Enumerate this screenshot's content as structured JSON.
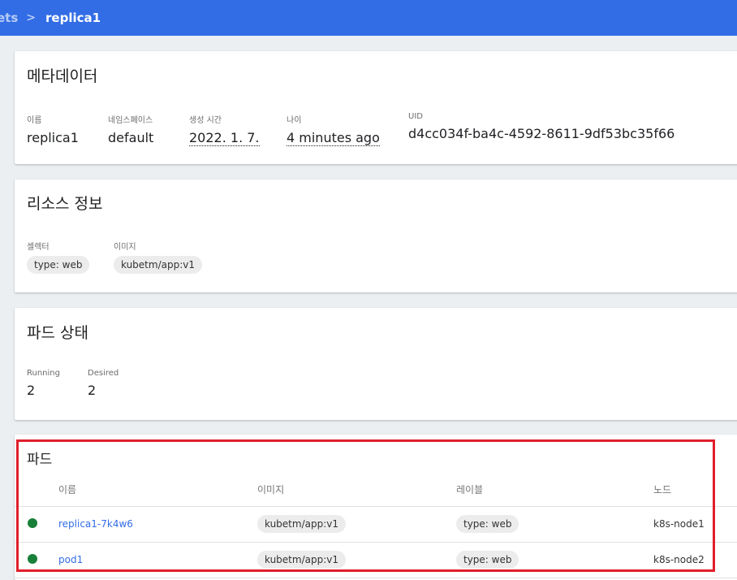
{
  "breadcrumb": {
    "previous": "ets",
    "separator": ">",
    "current": "replica1"
  },
  "metadata_card": {
    "title": "메타데이터",
    "fields": [
      {
        "label": "이름",
        "value": "replica1"
      },
      {
        "label": "네임스페이스",
        "value": "default"
      },
      {
        "label": "생성 시간",
        "value": "2022. 1. 7."
      },
      {
        "label": "나이",
        "value": "4 minutes ago"
      },
      {
        "label": "UID",
        "value": "d4cc034f-ba4c-4592-8611-9df53bc35f66"
      }
    ]
  },
  "resource_card": {
    "title": "리소스 정보",
    "selector_label": "셀렉터",
    "selector_chip": "type: web",
    "image_label": "이미지",
    "image_chip": "kubetm/app:v1"
  },
  "pod_status_card": {
    "title": "파드 상태",
    "running_label": "Running",
    "running_value": "2",
    "desired_label": "Desired",
    "desired_value": "2"
  },
  "pods_card": {
    "title": "파드",
    "columns": [
      "이름",
      "이미지",
      "레이블",
      "노드"
    ],
    "rows": [
      {
        "name": "replica1-7k4w6",
        "image": "kubetm/app:v1",
        "label": "type: web",
        "node": "k8s-node1",
        "status_color": "#188038"
      },
      {
        "name": "pod1",
        "image": "kubetm/app:v1",
        "label": "type: web",
        "node": "k8s-node2",
        "status_color": "#188038"
      }
    ]
  },
  "colors": {
    "topbar": "#326de6",
    "highlight": "#e01f2b",
    "status_ok": "#188038"
  }
}
